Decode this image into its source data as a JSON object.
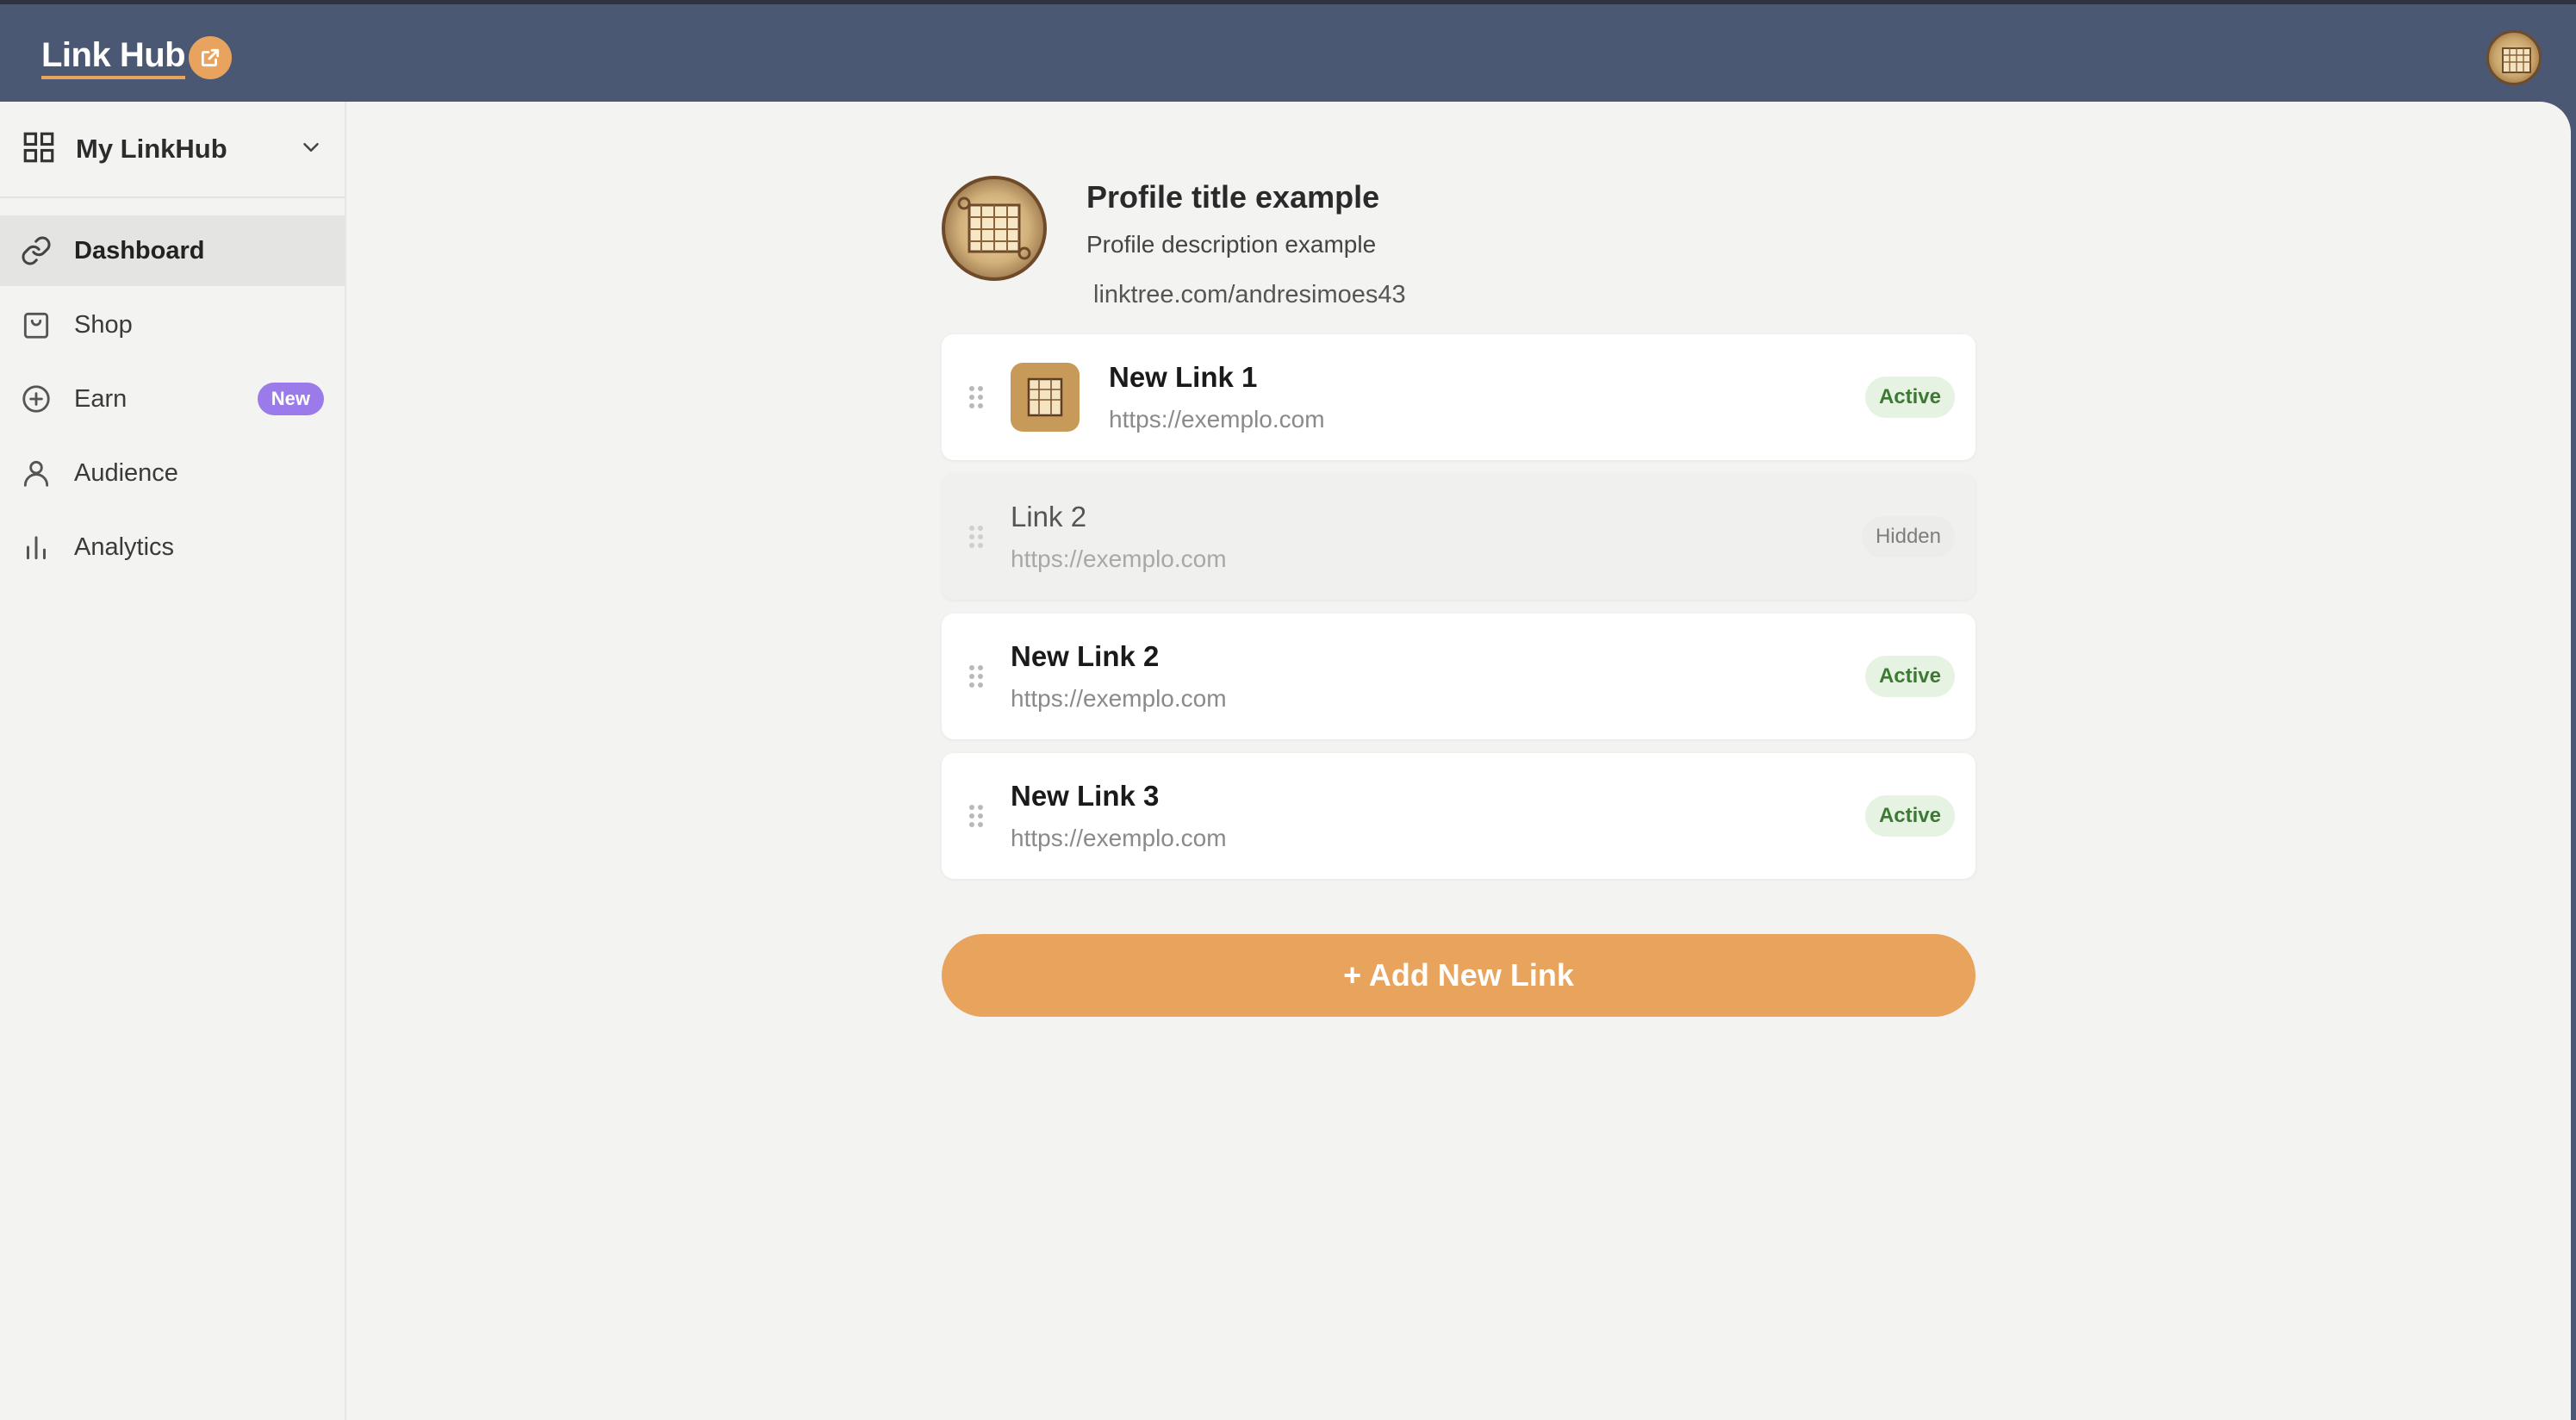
{
  "brand": {
    "name": "Link Hub"
  },
  "sidebar": {
    "workspace_label": "My LinkHub",
    "items": [
      {
        "label": "Dashboard",
        "icon": "link-icon",
        "active": true
      },
      {
        "label": "Shop",
        "icon": "shopping-bag-icon"
      },
      {
        "label": "Earn",
        "icon": "plus-circle-icon",
        "badge": "New"
      },
      {
        "label": "Audience",
        "icon": "person-icon"
      },
      {
        "label": "Analytics",
        "icon": "bar-chart-icon"
      }
    ]
  },
  "profile": {
    "title": "Profile title example",
    "description": "Profile description example",
    "url": "linktree.com/andresimoes43"
  },
  "links": [
    {
      "title": "New Link 1",
      "url": "https://exemplo.com",
      "status": "Active",
      "has_thumbnail": true
    },
    {
      "title": "Link 2",
      "url": "https://exemplo.com",
      "status": "Hidden",
      "has_thumbnail": false
    },
    {
      "title": "New Link 2",
      "url": "https://exemplo.com",
      "status": "Active",
      "has_thumbnail": false
    },
    {
      "title": "New Link 3",
      "url": "https://exemplo.com",
      "status": "Active",
      "has_thumbnail": false
    }
  ],
  "add_button_label": "+ Add New Link",
  "colors": {
    "topbar": "#4a5873",
    "accent": "#e8a35d",
    "badge_new": "#9b7bea",
    "active_status_bg": "#e6f3e3",
    "active_status_text": "#3c7a34"
  }
}
